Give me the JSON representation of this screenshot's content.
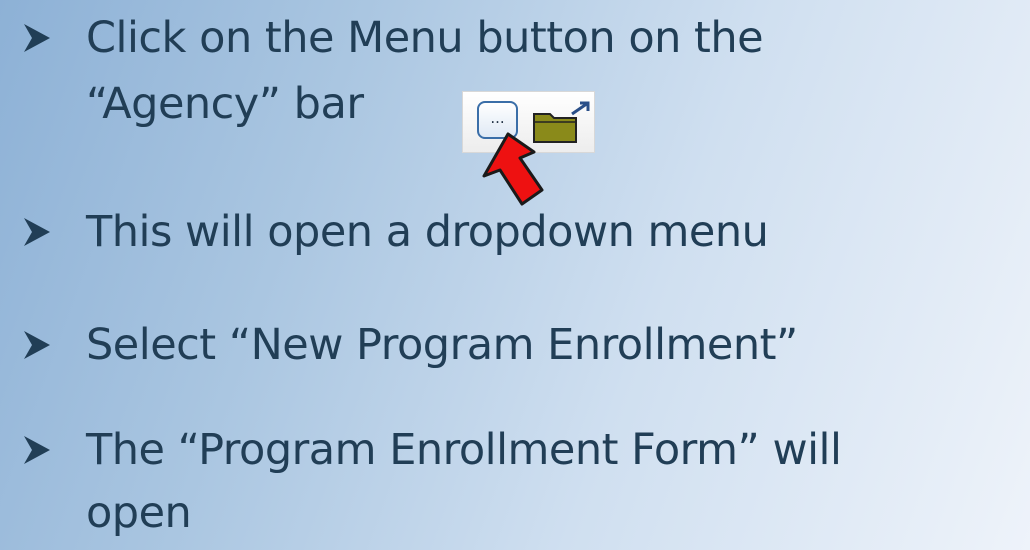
{
  "bullets": [
    {
      "line1": "Click on the Menu button on the",
      "line2": "“Agency” bar"
    },
    {
      "line1": "This will open a dropdown menu"
    },
    {
      "line1": "Select “New Program Enrollment”"
    },
    {
      "line1": "The “Program Enrollment Form” will",
      "line2": "open"
    }
  ],
  "toolbar": {
    "menu_button_label": "...",
    "menu_button_icon": "ellipsis-menu-icon",
    "folder_icon": "folder-open-icon",
    "pointer_icon": "red-arrow-icon"
  },
  "colors": {
    "text": "#213e56",
    "arrow": "#ee1111",
    "folder": "#8a8a1a"
  }
}
